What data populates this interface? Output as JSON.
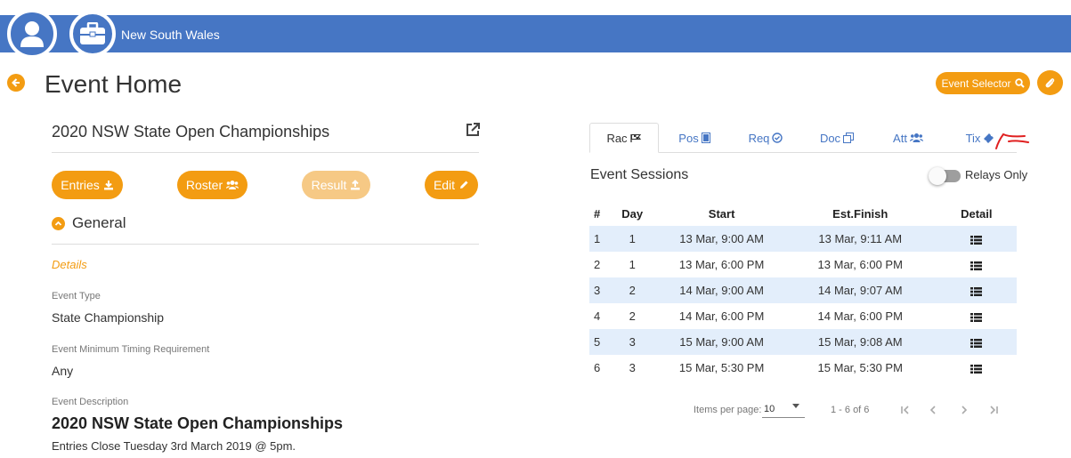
{
  "header": {
    "org_name": "New South Wales",
    "avatar_icon": "user-icon",
    "briefcase_icon": "briefcase-icon",
    "bar_color": "#4676c4",
    "accent_color": "#f39c12"
  },
  "page": {
    "title": "Event Home",
    "event_selector_label": "Event Selector"
  },
  "event": {
    "name": "2020 NSW State Open Championships",
    "buttons": {
      "entries": "Entries",
      "roster": "Roster",
      "result": "Result",
      "edit": "Edit"
    },
    "general_heading": "General",
    "details_label": "Details",
    "fields": {
      "event_type_label": "Event Type",
      "event_type_value": "State Championship",
      "min_timing_label": "Event Minimum Timing Requirement",
      "min_timing_value": "Any",
      "description_label": "Event Description"
    },
    "description_title": "2020 NSW State Open Championships",
    "description_text": "Entries Close Tuesday 3rd March 2019 @ 5pm."
  },
  "tabs": [
    {
      "label": "Rac",
      "icon": "flag-icon",
      "active": true
    },
    {
      "label": "Pos",
      "icon": "portrait-icon",
      "active": false
    },
    {
      "label": "Req",
      "icon": "check-circle-icon",
      "active": false
    },
    {
      "label": "Doc",
      "icon": "copy-icon",
      "active": false
    },
    {
      "label": "Att",
      "icon": "users-icon",
      "active": false
    },
    {
      "label": "Tix",
      "icon": "ticket-icon",
      "active": false
    }
  ],
  "sessions": {
    "heading": "Event Sessions",
    "relays_only_label": "Relays Only",
    "relays_only_on": false,
    "columns": [
      "#",
      "Day",
      "Start",
      "Est.Finish",
      "Detail"
    ],
    "rows": [
      {
        "num": "1",
        "day": "1",
        "start": "13 Mar, 9:00 AM",
        "finish": "13 Mar, 9:11 AM"
      },
      {
        "num": "2",
        "day": "1",
        "start": "13 Mar, 6:00 PM",
        "finish": "13 Mar, 6:00 PM"
      },
      {
        "num": "3",
        "day": "2",
        "start": "14 Mar, 9:00 AM",
        "finish": "14 Mar, 9:07 AM"
      },
      {
        "num": "4",
        "day": "2",
        "start": "14 Mar, 6:00 PM",
        "finish": "14 Mar, 6:00 PM"
      },
      {
        "num": "5",
        "day": "3",
        "start": "15 Mar, 9:00 AM",
        "finish": "15 Mar, 9:08 AM"
      },
      {
        "num": "6",
        "day": "3",
        "start": "15 Mar, 5:30 PM",
        "finish": "15 Mar, 5:30 PM"
      }
    ]
  },
  "pagination": {
    "items_per_page_label": "Items per page:",
    "items_per_page_value": "10",
    "range_label": "1 - 6 of 6"
  }
}
